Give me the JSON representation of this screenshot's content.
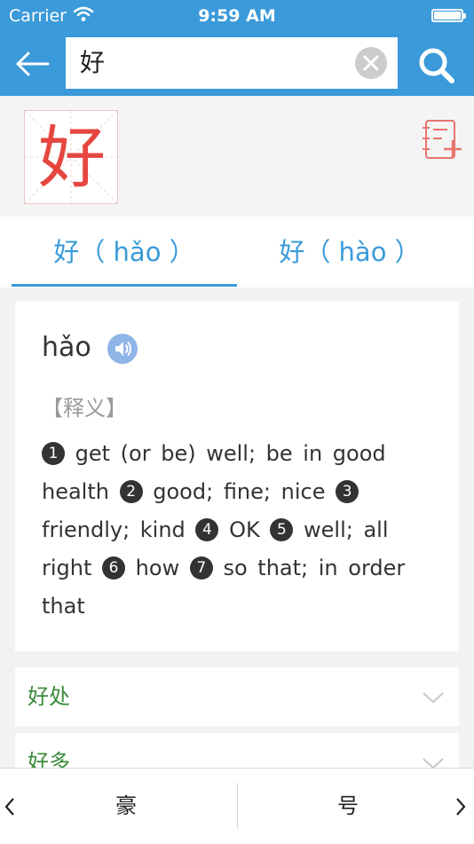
{
  "status_bar": {
    "carrier": "Carrier",
    "time": "9:59 AM"
  },
  "search": {
    "value": "好"
  },
  "character": {
    "glyph": "好"
  },
  "tabs": [
    {
      "label": "好（ hǎo ）",
      "selected": true
    },
    {
      "label": "好（ hào ）",
      "selected": false
    }
  ],
  "entry": {
    "pinyin": "hǎo",
    "section_label": "【释义】",
    "senses": [
      {
        "num": "1",
        "text": "get (or be) well; be in good health"
      },
      {
        "num": "2",
        "text": "good; fine; nice"
      },
      {
        "num": "3",
        "text": "friendly; kind"
      },
      {
        "num": "4",
        "text": "OK"
      },
      {
        "num": "5",
        "text": "well; all right"
      },
      {
        "num": "6",
        "text": "how"
      },
      {
        "num": "7",
        "text": "so that; in order that"
      }
    ]
  },
  "phrases": [
    {
      "label": "好处"
    },
    {
      "label": "好多"
    }
  ],
  "bottom_nav": {
    "prev_char": "豪",
    "next_char": "号"
  },
  "colors": {
    "accent": "#3b9ad9",
    "char_red": "#e6463f",
    "phrase_green": "#3a8a3a",
    "audio_blue": "#8fb4e6"
  },
  "icons": [
    "back-arrow-icon",
    "clear-icon",
    "search-icon",
    "add-to-notebook-icon",
    "speaker-icon",
    "chevron-down-icon",
    "chevron-left-icon",
    "chevron-right-icon",
    "wifi-icon",
    "battery-icon"
  ]
}
